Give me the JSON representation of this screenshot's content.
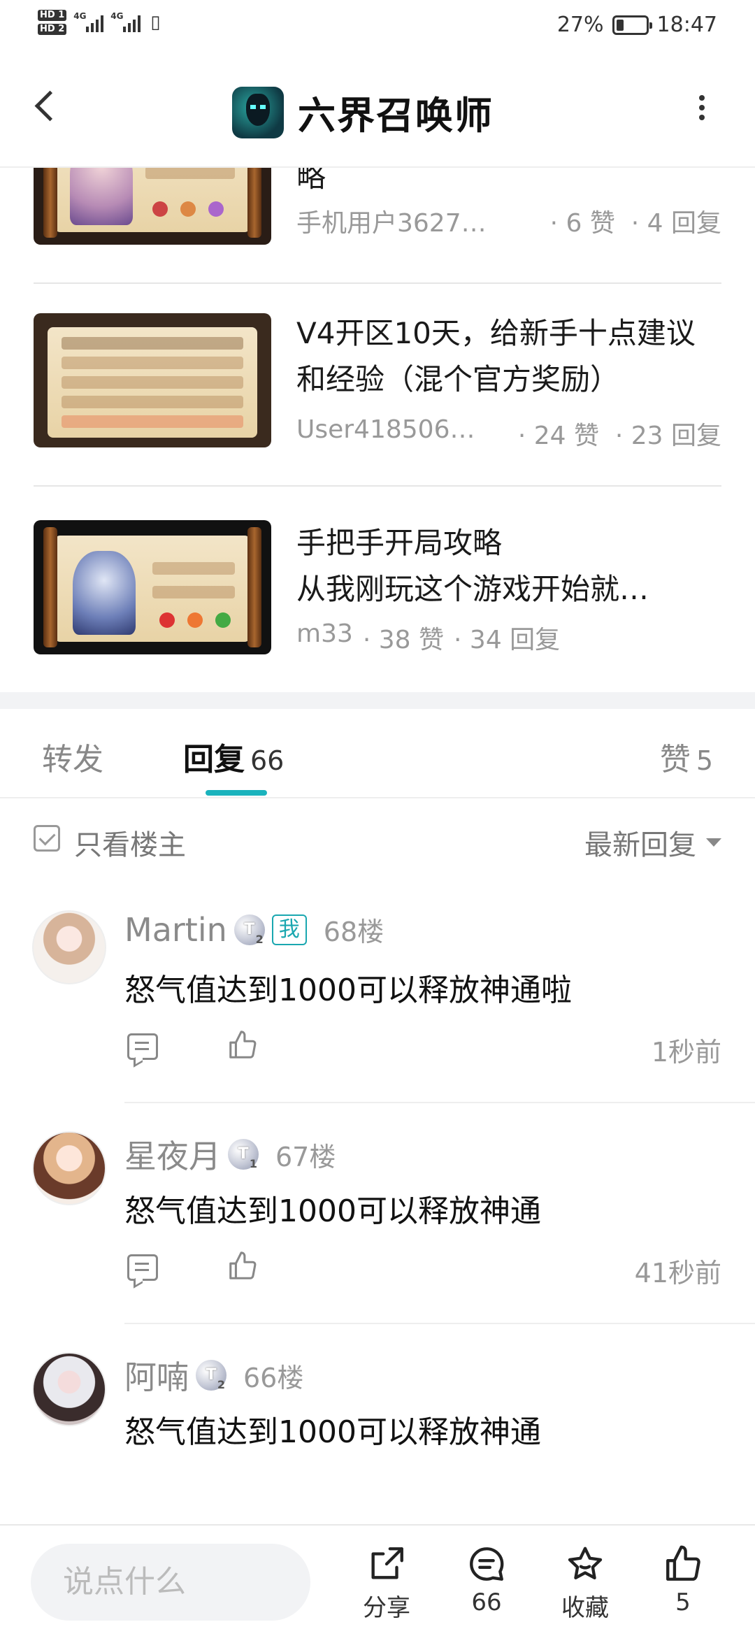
{
  "status_bar": {
    "hd1": "HD 1",
    "hd2": "HD 2",
    "net1": "4G",
    "net2": "4G",
    "battery_percent": "27%",
    "battery_level": 0.27,
    "time": "18:47"
  },
  "header": {
    "forum_name": "六界召唤师",
    "back_icon": "back-arrow-icon",
    "more_icon": "more-vertical-icon"
  },
  "related_posts": [
    {
      "title": "略",
      "author": "手机用户3627…",
      "likes": "· 6 赞",
      "replies": "· 4 回复"
    },
    {
      "title": "V4开区10天，给新手十点建议和经验（混个官方奖励）",
      "author": "User418506…",
      "likes": "· 24 赞",
      "replies": "· 23 回复"
    },
    {
      "title": "手把手开局攻略",
      "subtitle": "从我刚玩这个游戏开始就…",
      "author": "m33",
      "likes": "· 38 赞",
      "replies": "· 34 回复"
    }
  ],
  "tabs": {
    "forward": {
      "label": "转发"
    },
    "reply": {
      "label": "回复",
      "count": "66"
    },
    "like": {
      "label": "赞",
      "count": "5"
    }
  },
  "filter": {
    "only_op": "只看楼主",
    "sort": "最新回复"
  },
  "replies": [
    {
      "username": "Martin",
      "level": "T",
      "level_sub": "2",
      "me_badge": "我",
      "floor": "68楼",
      "content": "怒气值达到1000可以释放神通啦",
      "time": "1秒前"
    },
    {
      "username": "星夜月",
      "level": "T",
      "level_sub": "1",
      "floor": "67楼",
      "content": "怒气值达到1000可以释放神通",
      "time": "41秒前"
    },
    {
      "username": "阿喃",
      "level": "T",
      "level_sub": "2",
      "floor": "66楼",
      "content": "怒气值达到1000可以释放神通"
    }
  ],
  "bottom_bar": {
    "input_placeholder": "说点什么",
    "share": "分享",
    "comments": "66",
    "favorite": "收藏",
    "likes": "5"
  },
  "colors": {
    "accent": "#1ab3bd",
    "text": "#111111",
    "muted": "#999999"
  }
}
